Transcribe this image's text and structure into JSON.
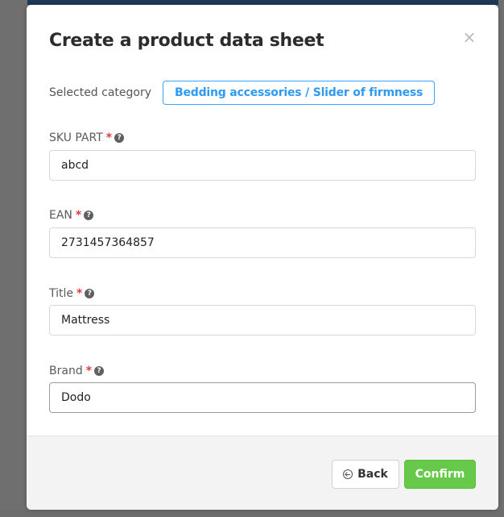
{
  "modal": {
    "title": "Create a product data sheet",
    "close_glyph": "×"
  },
  "category": {
    "label": "Selected category",
    "value": "Bedding accessories / Slider of firmness"
  },
  "fields": [
    {
      "label": "SKU PART",
      "required_mark": "*",
      "help_glyph": "?",
      "value": "abcd"
    },
    {
      "label": "EAN",
      "required_mark": "*",
      "help_glyph": "?",
      "value": "2731457364857"
    },
    {
      "label": "Title",
      "required_mark": "*",
      "help_glyph": "?",
      "value": "Mattress"
    },
    {
      "label": "Brand",
      "required_mark": "*",
      "help_glyph": "?",
      "value": "Dodo"
    }
  ],
  "footer": {
    "back_label": "Back",
    "confirm_label": "Confirm"
  },
  "icons": {
    "close": "close-icon",
    "help": "question-circle-icon",
    "back": "arrow-circle-left-icon"
  },
  "colors": {
    "accent_blue": "#2f9af2",
    "required_red": "#e03b3b",
    "confirm_green": "#66c94a",
    "title_text": "#2c2c2c"
  }
}
